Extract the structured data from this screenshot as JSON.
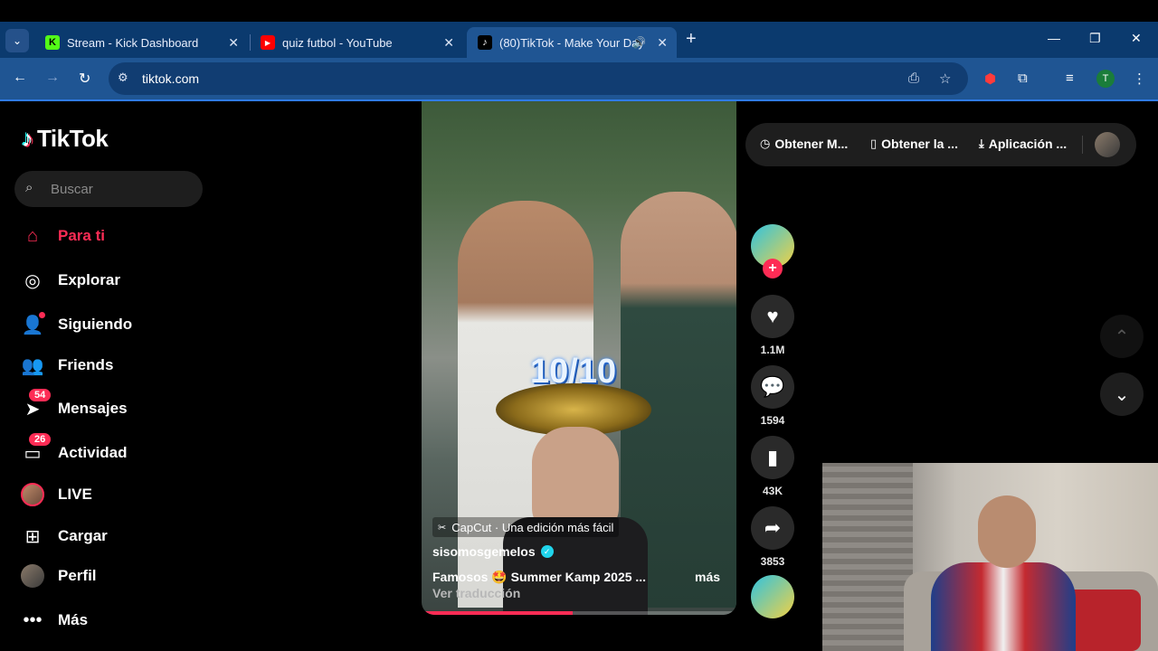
{
  "browser": {
    "tabs": [
      {
        "title": "Stream - Kick Dashboard",
        "favicon": "kick-icon",
        "color": "#53fc18",
        "active": false
      },
      {
        "title": "quiz futbol - YouTube",
        "favicon": "youtube-icon",
        "color": "#ff0000",
        "active": false
      },
      {
        "title": "(80)TikTok - Make Your Day",
        "favicon": "tiktok-icon",
        "color": "#000000",
        "active": true
      }
    ],
    "url": "tiktok.com",
    "profile_initial": "T"
  },
  "sidebar": {
    "logo": "TikTok",
    "search_placeholder": "Buscar",
    "items": [
      {
        "label": "Para ti",
        "icon": "home-icon",
        "active": true
      },
      {
        "label": "Explorar",
        "icon": "compass-icon"
      },
      {
        "label": "Siguiendo",
        "icon": "following-icon"
      },
      {
        "label": "Friends",
        "icon": "friends-icon"
      },
      {
        "label": "Mensajes",
        "icon": "inbox-icon",
        "badge": "54"
      },
      {
        "label": "Actividad",
        "icon": "activity-icon",
        "badge": "26"
      },
      {
        "label": "LIVE",
        "icon": "live-avatar"
      },
      {
        "label": "Cargar",
        "icon": "upload-icon"
      },
      {
        "label": "Perfil",
        "icon": "profile-avatar"
      },
      {
        "label": "Más",
        "icon": "more-icon"
      }
    ]
  },
  "video": {
    "overlay_text": "10/10",
    "capcut_tag": "CapCut · Una edición más fácil",
    "author": "sisomosgemelos",
    "description": "Famosos 🤩 Summer Kamp 2025 ...",
    "more_label": "más",
    "translate_label": "Ver traducción",
    "progress": 0.48
  },
  "actions": {
    "likes": "1.1M",
    "comments": "1594",
    "saves": "43K",
    "shares": "3853"
  },
  "top_pill": {
    "items": [
      "Obtener M...",
      "Obtener la ...",
      "Aplicación ..."
    ]
  },
  "colors": {
    "brand": "#fe2c55",
    "browser_tabstrip": "#0b3a6e",
    "browser_toolbar": "#1f5593"
  }
}
